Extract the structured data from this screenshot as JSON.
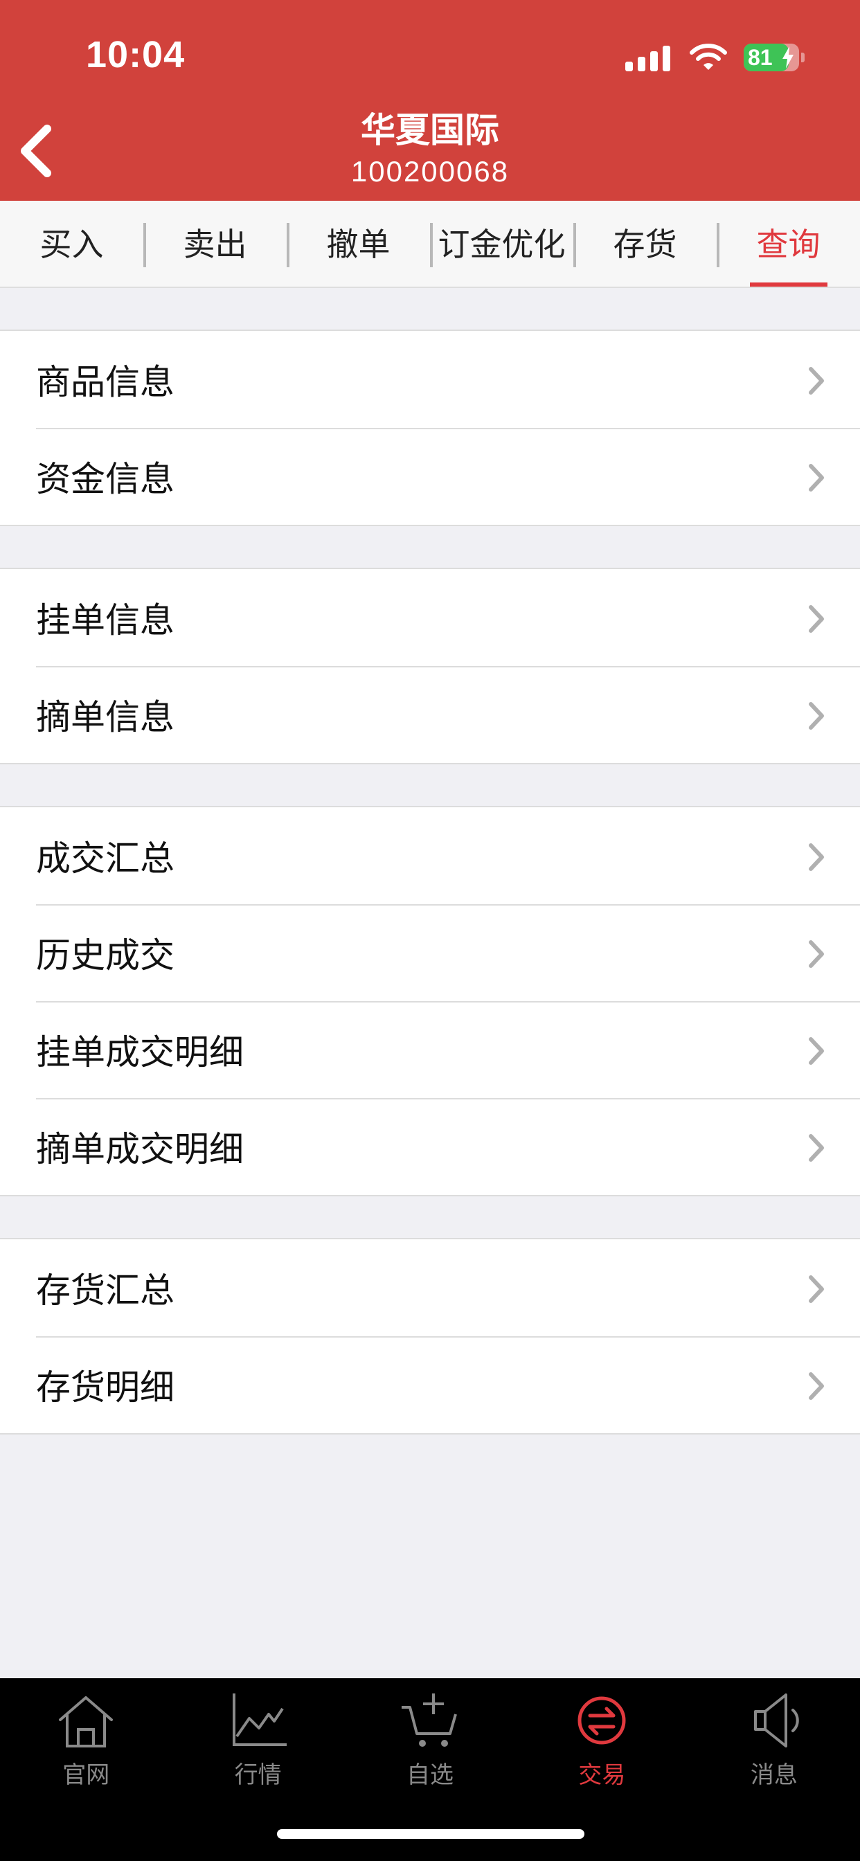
{
  "status_bar": {
    "time": "10:04",
    "battery": "81"
  },
  "header": {
    "title": "华夏国际",
    "account": "100200068"
  },
  "tabs": [
    {
      "label": "买入"
    },
    {
      "label": "卖出"
    },
    {
      "label": "撤单"
    },
    {
      "label": "订金优化"
    },
    {
      "label": "存货"
    },
    {
      "label": "查询"
    }
  ],
  "active_tab": "查询",
  "groups": [
    {
      "items": [
        {
          "label": "商品信息"
        },
        {
          "label": "资金信息"
        }
      ]
    },
    {
      "items": [
        {
          "label": "挂单信息"
        },
        {
          "label": "摘单信息"
        }
      ]
    },
    {
      "items": [
        {
          "label": "成交汇总"
        },
        {
          "label": "历史成交"
        },
        {
          "label": "挂单成交明细"
        },
        {
          "label": "摘单成交明细"
        }
      ]
    },
    {
      "items": [
        {
          "label": "存货汇总"
        },
        {
          "label": "存货明细"
        }
      ]
    }
  ],
  "bottom_nav": [
    {
      "label": "官网",
      "icon": "home-icon"
    },
    {
      "label": "行情",
      "icon": "chart-icon"
    },
    {
      "label": "自选",
      "icon": "cart-icon"
    },
    {
      "label": "交易",
      "icon": "exchange-icon"
    },
    {
      "label": "消息",
      "icon": "speaker-icon"
    }
  ],
  "active_nav": "交易",
  "colors": {
    "brand": "#d1423c",
    "accent": "#e0393e",
    "battery": "#3ec356"
  }
}
